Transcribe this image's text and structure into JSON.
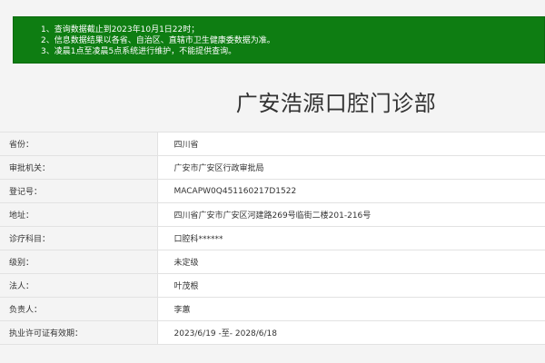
{
  "notice": {
    "lines": [
      "1、查询数据截止到2023年10月1日22时；",
      "2、信息数据结果以各省、自治区、直辖市卫生健康委数据为准。",
      "3、凌晨1点至凌晨5点系统进行维护，不能提供查询。"
    ]
  },
  "clinic": {
    "title": "广安浩源口腔门诊部"
  },
  "details": [
    {
      "label": "省份：",
      "value": "四川省"
    },
    {
      "label": "审批机关：",
      "value": "广安市广安区行政审批局"
    },
    {
      "label": "登记号：",
      "value": "MACAPW0Q451160217D1522"
    },
    {
      "label": "地址：",
      "value": "四川省广安市广安区河建路269号临街二楼201-216号"
    },
    {
      "label": "诊疗科目：",
      "value": "口腔科******"
    },
    {
      "label": "级别：",
      "value": "未定级"
    },
    {
      "label": "法人：",
      "value": "叶茂根"
    },
    {
      "label": "负责人：",
      "value": "李蕙"
    },
    {
      "label": "执业许可证有效期：",
      "value": "2023/6/19 -至- 2028/6/18"
    }
  ]
}
